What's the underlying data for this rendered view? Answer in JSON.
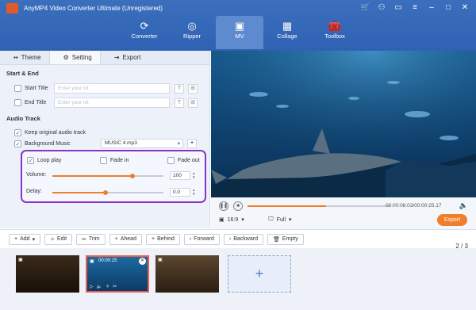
{
  "app": {
    "title": "AnyMP4 Video Converter Ultimate (Unregistered)"
  },
  "nav": [
    {
      "label": "Converter",
      "icon": "converter-icon"
    },
    {
      "label": "Ripper",
      "icon": "ripper-icon"
    },
    {
      "label": "MV",
      "icon": "mv-icon",
      "active": true
    },
    {
      "label": "Collage",
      "icon": "collage-icon"
    },
    {
      "label": "Toolbox",
      "icon": "toolbox-icon"
    }
  ],
  "tabs": {
    "theme": "Theme",
    "setting": "Setting",
    "export": "Export"
  },
  "start_end": {
    "heading": "Start & End",
    "start_title": "Start Title",
    "end_title": "End Title",
    "placeholder": "Enter your txt"
  },
  "audio": {
    "heading": "Audio Track",
    "keep_original": "Keep original audio track",
    "background_music": "Background Music",
    "music_file": "MUSIC 4.mp3",
    "loop_play": "Loop play",
    "fade_in": "Fade in",
    "fade_out": "Fade out",
    "volume_label": "Volume:",
    "volume_value": "100",
    "volume_level": 0.72,
    "delay_label": "Delay:",
    "delay_value": "0.0",
    "delay_level": 0.48
  },
  "player": {
    "time": "00:00:08.03/00:00:25.17",
    "playback_progress": 0.55,
    "aspect": "16:9",
    "view": "Full",
    "export": "Export"
  },
  "toolbar": {
    "add": "Add",
    "edit": "Edit",
    "trim": "Trim",
    "ahead": "Ahead",
    "behind": "Behind",
    "forward": "Forward",
    "backward": "Backward",
    "empty": "Empty",
    "page": "2 / 3"
  },
  "timeline": {
    "selected_clip_time": "00:00:15"
  },
  "colors": {
    "accent": "#f07e2b",
    "brand": "#2f62b2",
    "highlight": "#8a34c7"
  }
}
